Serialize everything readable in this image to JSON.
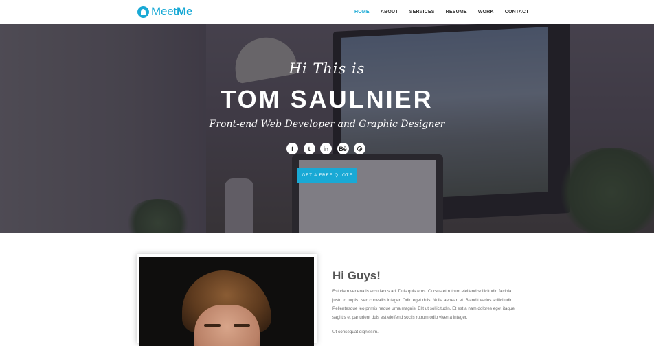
{
  "brand": {
    "name_light": "Meet",
    "name_bold": "Me",
    "accent_color": "#19a9d5"
  },
  "nav": {
    "items": [
      {
        "label": "HOME",
        "active": true
      },
      {
        "label": "ABOUT",
        "active": false
      },
      {
        "label": "SERVICES",
        "active": false
      },
      {
        "label": "RESUME",
        "active": false
      },
      {
        "label": "WORK",
        "active": false
      },
      {
        "label": "CONTACT",
        "active": false
      }
    ]
  },
  "hero": {
    "greeting": "Hi This is",
    "name": "TOM SAULNIER",
    "role": "Front-end Web Developer and Graphic Designer",
    "socials": [
      {
        "icon": "facebook-icon",
        "glyph": "f"
      },
      {
        "icon": "twitter-icon",
        "glyph": "t"
      },
      {
        "icon": "linkedin-icon",
        "glyph": "in"
      },
      {
        "icon": "behance-icon",
        "glyph": "Bē"
      },
      {
        "icon": "dribbble-icon",
        "glyph": "◎"
      }
    ],
    "cta_label": "GET A FREE QUOTE"
  },
  "about": {
    "title": "Hi Guys!",
    "paragraph": "Est clam venenatis arcu lacus ad. Duis quis eros. Cursus et rutrum eleifend sollicitudin facinia justo id turpis. Nec convallis integer. Odio eget duis. Nulla aenean et. Blandit varius sollicitudin. Pellentesque leo primis neque urna magnis. Elit ut sollicitudin. Et est a nam dolores eget itaque sagittis et parturient duis est eleifend sociis rutrum odio viverra integer.",
    "paragraph2": "Ut consequat dignissim."
  }
}
